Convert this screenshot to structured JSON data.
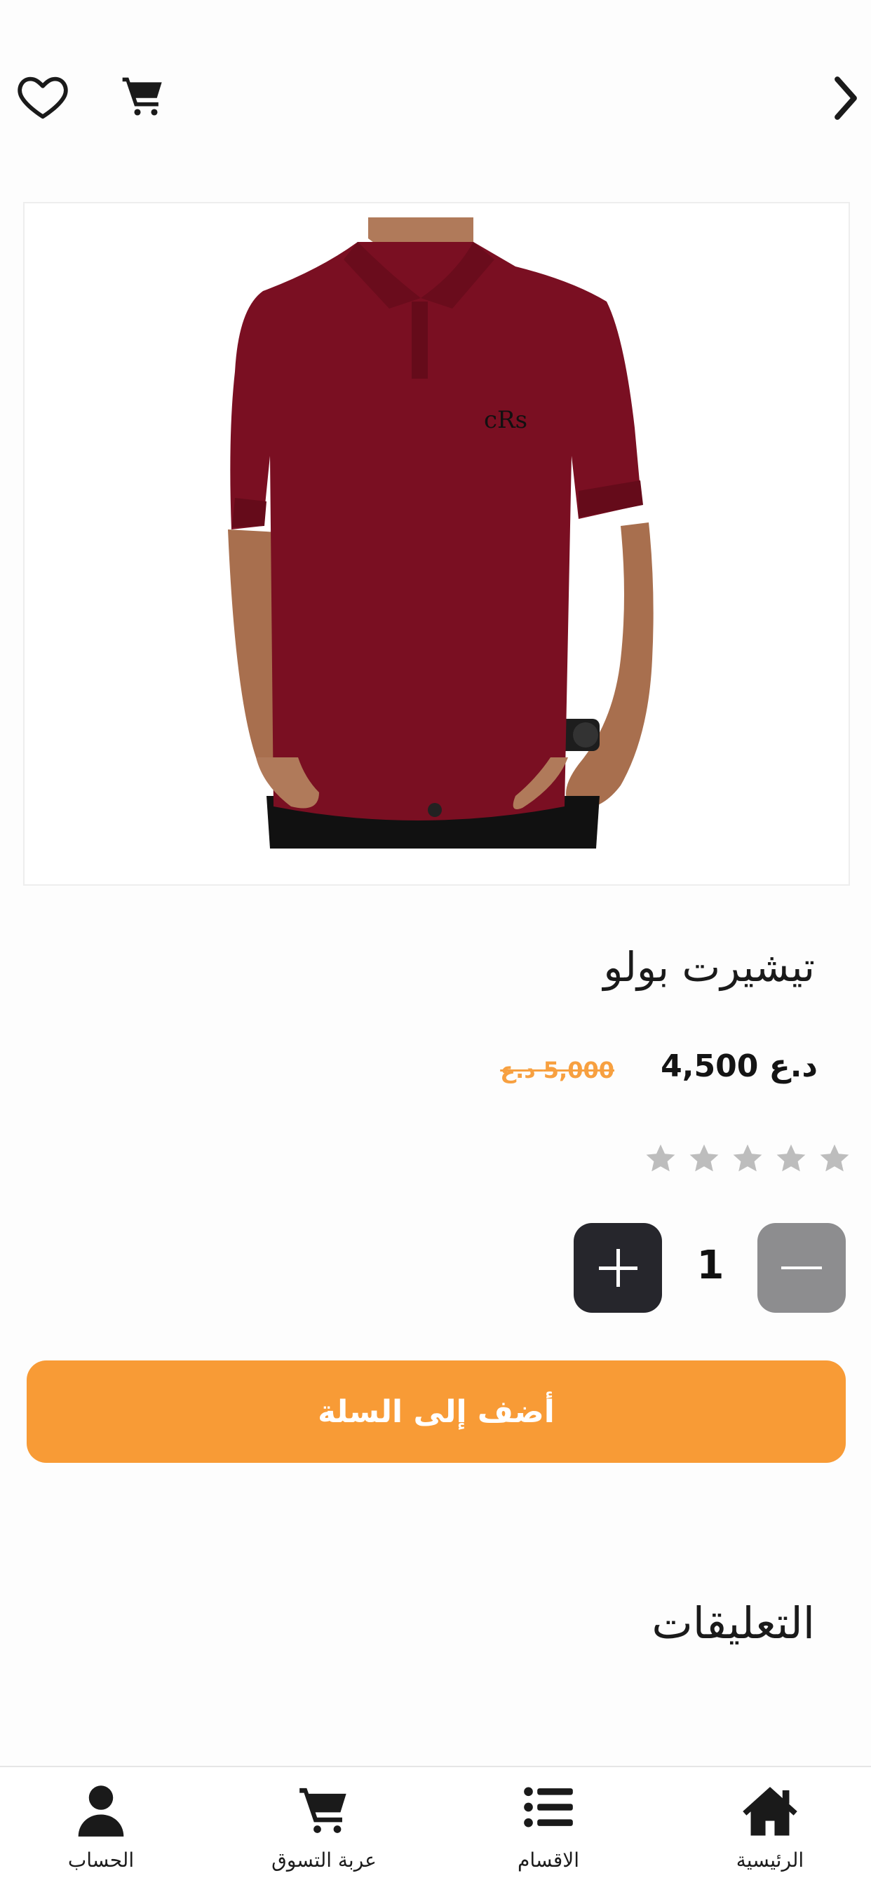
{
  "product": {
    "title": "تيشيرت بولو",
    "price_current": "د.ع  4,500",
    "price_old": "5,000 د.ع",
    "rating": 0,
    "rating_max": 5
  },
  "quantity": {
    "value": "1"
  },
  "add_to_cart_label": "أضف إلى السلة",
  "comments_title": "التعليقات",
  "nav": {
    "home": "الرئيسية",
    "categories": "الاقسام",
    "cart": "عربة التسوق",
    "account": "الحساب"
  },
  "colors": {
    "accent": "#f89b36",
    "old_price": "#f7a040",
    "plus_button": "#26262c",
    "minus_button": "#8d8d8f",
    "shirt": "#7a0f22"
  },
  "icons": [
    "heart-icon",
    "cart-icon",
    "chevron-right-icon",
    "star-icon",
    "plus-icon",
    "minus-icon",
    "home-icon",
    "list-icon",
    "cart-icon",
    "user-icon"
  ]
}
